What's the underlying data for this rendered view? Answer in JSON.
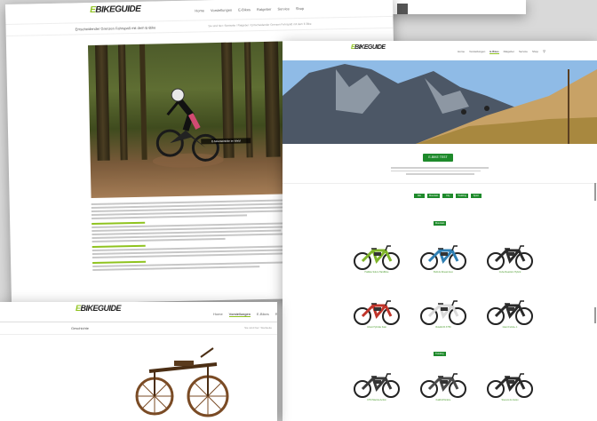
{
  "logo": {
    "e": "E",
    "rest": "BIKEGUIDE"
  },
  "back_page": {
    "nav": [
      "Home",
      "Vorstellungen",
      "E-Bikes",
      "Ratgeber",
      "Service",
      "Shop"
    ],
    "title": "Entscheidender Grenzen Fahrspaß mit dem E-Bike",
    "breadcrumb": "Sie sind hier: Startseite / Ratgeber / Entscheidender Grenzen Fahrspaß mit dem E-Bike",
    "photo_caption": "E-Mountainbike im Wald"
  },
  "right_page": {
    "nav": [
      "Home",
      "Vorstellungen",
      "E-Bikes",
      "Ratgeber",
      "Service",
      "Shop"
    ],
    "active_nav": 2,
    "cta_label": "E-BIKE TEST",
    "filters": [
      "Alle",
      "Mountain",
      "City",
      "Trekking",
      "Sport"
    ],
    "category_1": "Mountain",
    "category_2": "Trekking",
    "row1": [
      {
        "name": "Haibike Sduro HardNine",
        "frame": "#7fb52a"
      },
      {
        "name": "Bulls E-Stream Evo",
        "frame": "#2f7fb3"
      },
      {
        "name": "Cube Reaction Hybrid",
        "frame": "#2a2a2a"
      }
    ],
    "row2": [
      {
        "name": "Ghost Hybride Kato",
        "frame": "#c0342a"
      },
      {
        "name": "Rotwild R.X750",
        "frame": "#d9d9d9"
      },
      {
        "name": "Giant Full-E+ 1",
        "frame": "#2a2a2a"
      }
    ],
    "row3": [
      {
        "name": "KTM Macina Action",
        "frame": "#3a3a3a"
      },
      {
        "name": "Kalkhoff Entice",
        "frame": "#4a4a4a"
      },
      {
        "name": "Stevens E-Carpo",
        "frame": "#2a2a2a"
      }
    ]
  },
  "bottom_page": {
    "nav": [
      "Home",
      "Vorstellungen",
      "E-Bikes",
      "Ratgeber"
    ],
    "active_nav": 1,
    "title": "Geschichte",
    "breadcrumb": "Sie sind hier: Startseite"
  },
  "colors": {
    "brand_green": "#8fc31f",
    "button_green": "#1e8a2b"
  }
}
